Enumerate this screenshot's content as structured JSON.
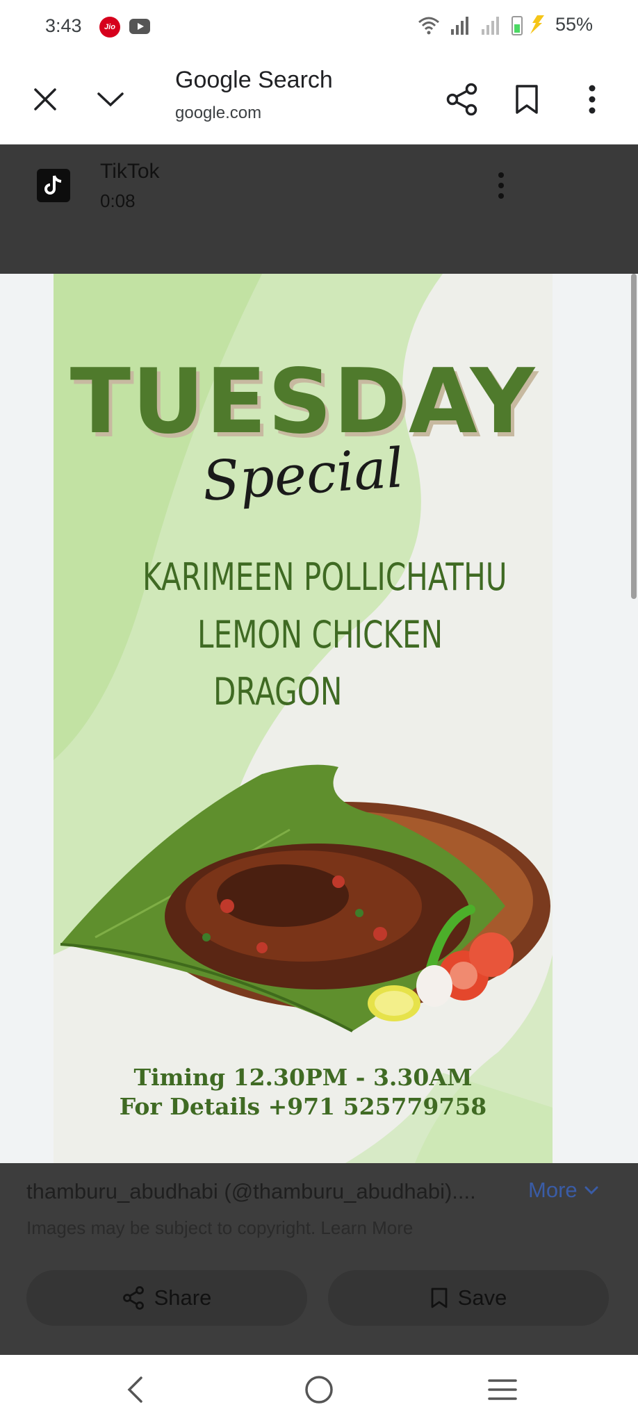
{
  "status_bar": {
    "time": "3:43",
    "carrier_badge": "Jio",
    "battery": "55%",
    "icons": [
      "jio-icon",
      "youtube-icon",
      "wifi-icon",
      "signal-icon",
      "signal-weak-icon",
      "battery-charging-icon"
    ]
  },
  "app_bar": {
    "title": "Google Search",
    "url": "google.com",
    "icons": [
      "close-icon",
      "chevron-down-icon",
      "share-icon",
      "bookmark-icon",
      "more-vert-icon"
    ]
  },
  "result": {
    "source_name": "TikTok",
    "duration": "0:08"
  },
  "poster": {
    "heading": "TUESDAY",
    "subheading": "Special",
    "menu_items": [
      "KARIMEEN POLLICHATHU",
      "LEMON CHICKEN",
      "DRAGON"
    ],
    "timing": "Timing 12.30PM - 3.30AM",
    "details": "For Details +971 525779758"
  },
  "info": {
    "source_line": "thamburu_abudhabi (@thamburu_abudhabi)....",
    "more_label": "More",
    "copyright": "Images may be subject to copyright. Learn More",
    "share_label": "Share",
    "save_label": "Save"
  },
  "nav_bar": {
    "icons": [
      "back-icon",
      "home-icon",
      "recents-icon"
    ]
  },
  "colors": {
    "sheet_dark": "#3d3d3d",
    "poster_green": "#4f7a2c",
    "link_blue": "#3a5ca6"
  }
}
